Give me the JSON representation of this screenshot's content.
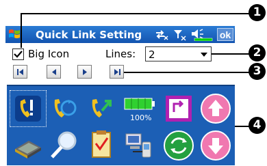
{
  "titlebar": {
    "title": "Quick Link Setting",
    "ok_label": "ok"
  },
  "settings": {
    "big_icon_label": "Big Icon",
    "big_icon_checked": true,
    "lines_label": "Lines:",
    "lines_value": "2"
  },
  "nav": {
    "buttons": [
      "first-icon",
      "previous-icon",
      "next-icon",
      "last-icon"
    ]
  },
  "icons": {
    "battery_text": "100%",
    "items": [
      "phone-alert-icon",
      "phone-refresh-icon",
      "phone-arrow-icon",
      "battery-icon",
      "rotate-screen-icon",
      "scroll-up-icon",
      "memory-chip-icon",
      "search-icon",
      "task-checklist-icon",
      "sync-devices-icon",
      "refresh-circle-icon",
      "scroll-down-icon"
    ]
  },
  "callouts": [
    "1",
    "2",
    "3",
    "4"
  ],
  "colors": {
    "titlebar": "#1a63c4",
    "panel": "#1c5fb5",
    "callout": "#000000"
  }
}
